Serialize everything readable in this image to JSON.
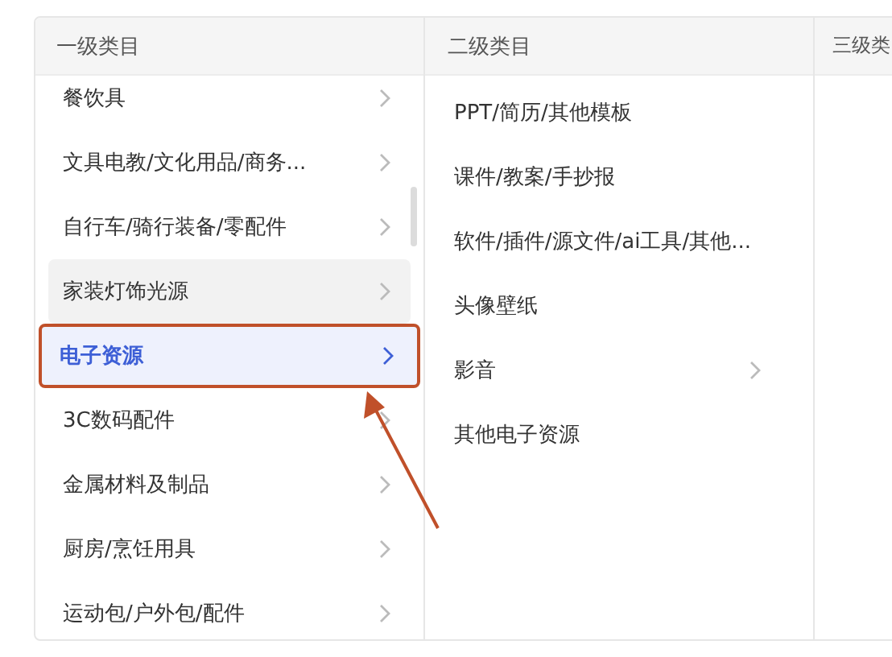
{
  "columns": [
    {
      "title": "一级类目",
      "items": [
        {
          "label": "餐饮具",
          "has_children": true,
          "hovered": false,
          "selected": false
        },
        {
          "label": "文具电教/文化用品/商务...",
          "has_children": true,
          "hovered": false,
          "selected": false
        },
        {
          "label": "自行车/骑行装备/零配件",
          "has_children": true,
          "hovered": false,
          "selected": false
        },
        {
          "label": "家装灯饰光源",
          "has_children": true,
          "hovered": true,
          "selected": false
        },
        {
          "label": "电子资源",
          "has_children": true,
          "hovered": false,
          "selected": true
        },
        {
          "label": "3C数码配件",
          "has_children": true,
          "hovered": false,
          "selected": false
        },
        {
          "label": "金属材料及制品",
          "has_children": true,
          "hovered": false,
          "selected": false
        },
        {
          "label": "厨房/烹饪用具",
          "has_children": true,
          "hovered": false,
          "selected": false
        },
        {
          "label": "运动包/户外包/配件",
          "has_children": true,
          "hovered": false,
          "selected": false
        }
      ]
    },
    {
      "title": "二级类目",
      "items": [
        {
          "label": "PPT/简历/其他模板",
          "has_children": false,
          "hovered": false,
          "selected": false
        },
        {
          "label": "课件/教案/手抄报",
          "has_children": false,
          "hovered": false,
          "selected": false
        },
        {
          "label": "软件/插件/源文件/ai工具/其他...",
          "has_children": false,
          "hovered": false,
          "selected": false
        },
        {
          "label": "头像壁纸",
          "has_children": false,
          "hovered": false,
          "selected": false
        },
        {
          "label": "影音",
          "has_children": true,
          "hovered": false,
          "selected": false
        },
        {
          "label": "其他电子资源",
          "has_children": false,
          "hovered": false,
          "selected": false
        }
      ]
    },
    {
      "title": "三级类"
    }
  ]
}
